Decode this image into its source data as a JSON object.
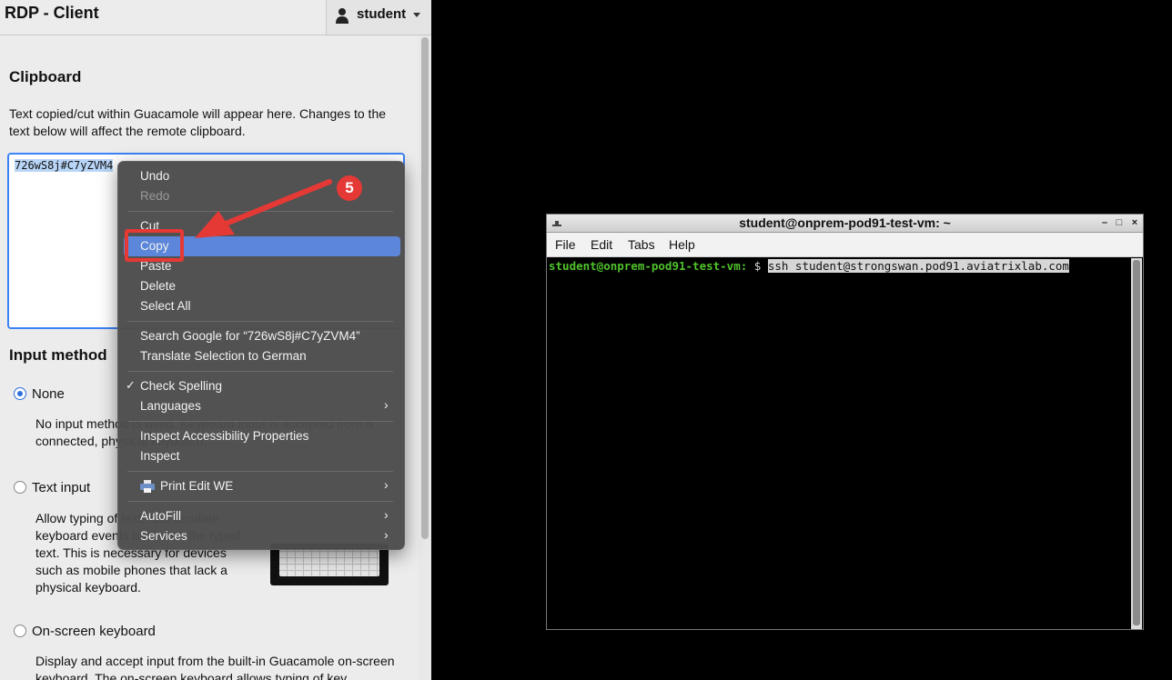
{
  "panel": {
    "title": "RDP - Client",
    "user": "student",
    "clipboard": {
      "heading": "Clipboard",
      "description": "Text copied/cut within Guacamole will appear here. Changes to the text below will affect the remote clipboard.",
      "value": "726wS8j#C7yZVM4"
    },
    "input_method": {
      "heading": "Input method",
      "options": [
        {
          "label": "None",
          "selected": true,
          "description": "No input method is used. Keyboard input is accepted from a connected, physical keyboard."
        },
        {
          "label": "Text input",
          "selected": false,
          "description": "Allow typing of text, and emulate keyboard events based on the typed text. This is necessary for devices such as mobile phones that lack a physical keyboard."
        },
        {
          "label": "On-screen keyboard",
          "selected": false,
          "description": "Display and accept input from the built-in Guacamole on-screen keyboard. The on-screen keyboard allows typing of key combinations that may otherwise be impossible."
        }
      ]
    }
  },
  "terminal": {
    "title": "student@onprem-pod91-test-vm: ~",
    "menus": [
      "File",
      "Edit",
      "Tabs",
      "Help"
    ],
    "prompt": "student@onprem-pod91-test-vm:",
    "prompt_suffix": " $ ",
    "command": "ssh student@strongswan.pod91.aviatrixlab.com"
  },
  "context_menu": {
    "groups": [
      [
        "Undo",
        "Redo"
      ],
      [
        "Cut",
        "Copy",
        "Paste",
        "Delete",
        "Select All"
      ],
      [
        "Search Google for “726wS8j#C7yZVM4”",
        "Translate Selection to German"
      ],
      [
        "Check Spelling",
        "Languages"
      ],
      [
        "Inspect Accessibility Properties",
        "Inspect"
      ],
      [
        "Print Edit WE"
      ],
      [
        "AutoFill",
        "Services"
      ]
    ],
    "highlighted": "Copy",
    "disabled": [
      "Redo"
    ],
    "checked": [
      "Check Spelling"
    ],
    "submenus": [
      "Languages",
      "Print Edit WE",
      "AutoFill",
      "Services"
    ],
    "highlight_color": "#5b86d9"
  },
  "annotation": {
    "step": "5",
    "color": "#e53935"
  }
}
